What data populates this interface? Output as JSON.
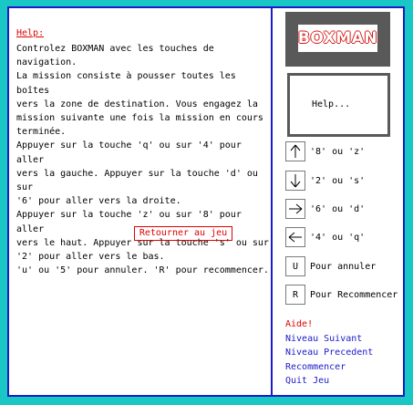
{
  "help_panel": {
    "title": "Help:",
    "lines": [
      "Controlez BOXMAN avec les touches de navigation.",
      "La mission consiste à pousser toutes les boîtes",
      "vers la zone de destination. Vous engagez la",
      "mission suivante une fois la mission en cours",
      "terminée.",
      "Appuyer sur la touche 'q' ou sur '4' pour aller",
      "vers la gauche. Appuyer sur la touche 'd' ou sur",
      "'6' pour aller vers la droite.",
      "Appuyer sur la touche 'z' ou sur '8' pour aller",
      "vers le haut. Appuyer sur la touche 's' ou sur",
      "'2' pour aller vers le bas.",
      "'u' ou '5' pour annuler. 'R' pour recommencer."
    ],
    "return_label": "Retourner au jeu"
  },
  "sidebar": {
    "logo_text": "BOXMAN",
    "status_text": "Help...",
    "keys": [
      {
        "icon": "arrow-up-icon",
        "label": "'8' ou 'z'"
      },
      {
        "icon": "arrow-down-icon",
        "label": "'2' ou 's'"
      },
      {
        "icon": "arrow-right-icon",
        "label": "'6' ou 'd'"
      },
      {
        "icon": "arrow-left-icon",
        "label": "'4' ou 'q'"
      },
      {
        "icon": "letter-u",
        "glyph": "U",
        "label": "Pour annuler"
      },
      {
        "icon": "letter-r",
        "glyph": "R",
        "label": "Pour Recommencer"
      }
    ],
    "menu_title": "Aide!",
    "menu_items": [
      "Niveau Suivant",
      "Niveau Precedent",
      "Recommencer",
      "Quit Jeu"
    ]
  },
  "colors": {
    "background": "#19c7c4",
    "border": "#1b1bc8",
    "accent_red": "#e00000",
    "link_blue": "#1b1bc8",
    "logo_box": "#595959"
  }
}
